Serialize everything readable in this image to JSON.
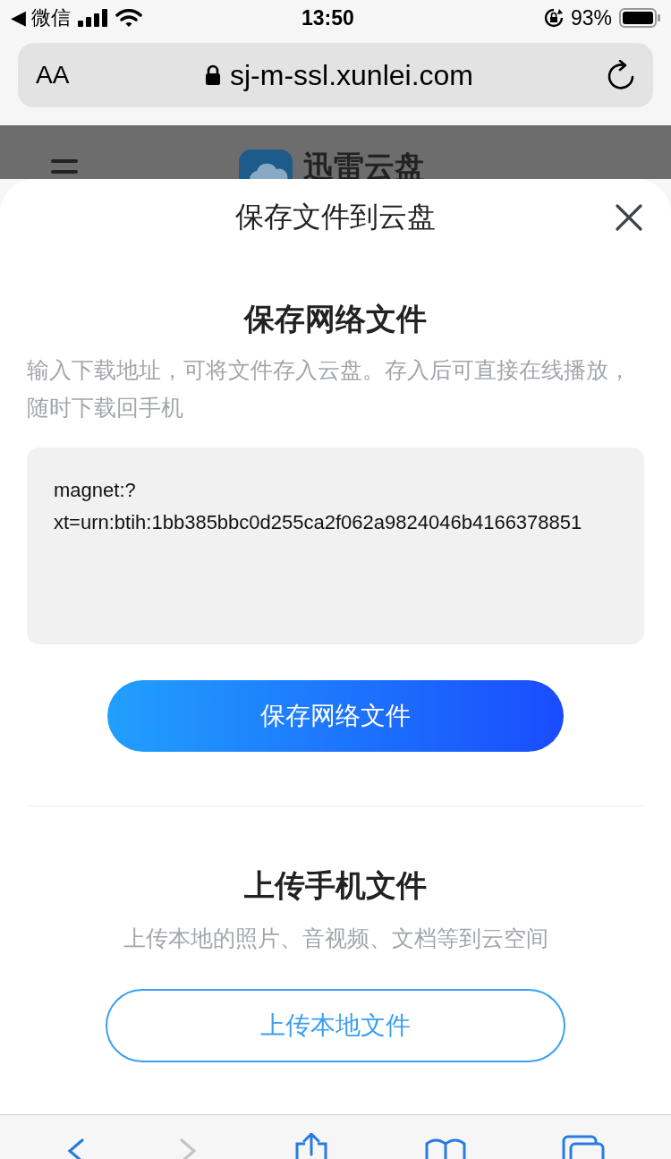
{
  "status_bar": {
    "back_app": "◀ 微信",
    "time": "13:50",
    "battery": "93%"
  },
  "address_bar": {
    "text_size": "AA",
    "url": "sj-m-ssl.xunlei.com"
  },
  "page_header": {
    "site_name": "迅雷云盘"
  },
  "sheet": {
    "title": "保存文件到云盘",
    "network_section": {
      "heading": "保存网络文件",
      "description": "输入下载地址，可将文件存入云盘。存入后可直接在线播放，随时下载回手机",
      "link_value": "magnet:?xt=urn:btih:1bb385bbc0d255ca2f062a9824046b4166378851",
      "button": "保存网络文件"
    },
    "upload_section": {
      "heading": "上传手机文件",
      "description": "上传本地的照片、音视频、文档等到云空间",
      "button": "上传本地文件"
    }
  },
  "toolbar": {
    "back_enabled": true,
    "forward_enabled": false
  }
}
